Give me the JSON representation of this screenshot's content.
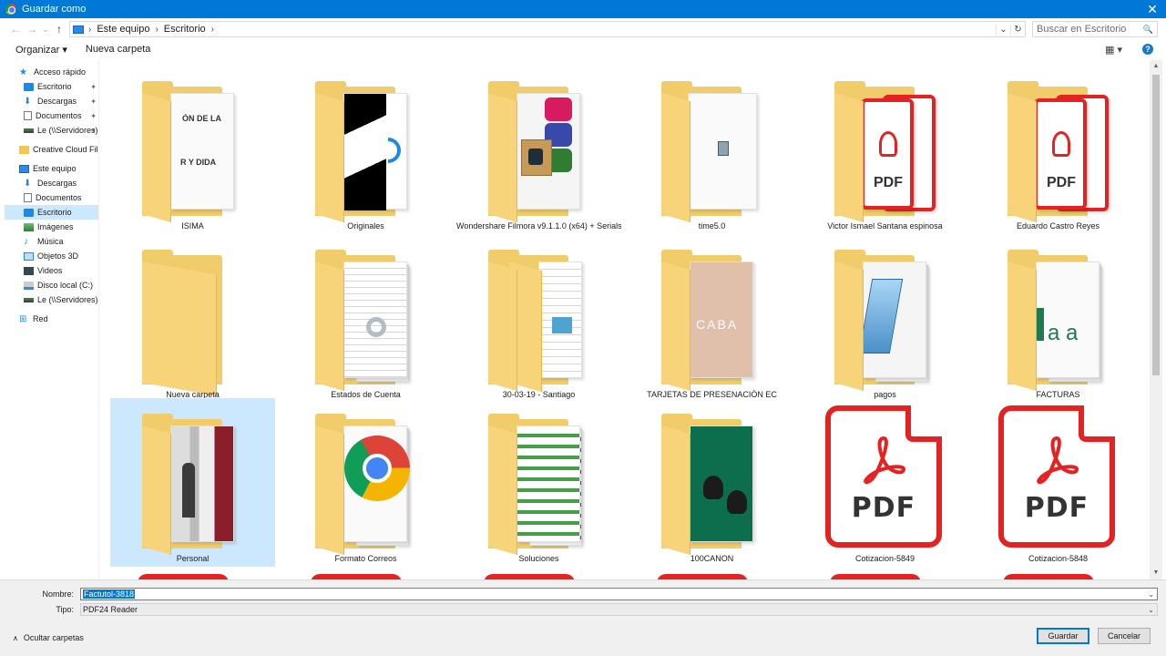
{
  "window": {
    "title": "Guardar como",
    "close_glyph": "✕",
    "app_icon": "chrome-icon"
  },
  "nav": {
    "back": "←",
    "forward": "→",
    "recent": "⌄",
    "up": "↑"
  },
  "address": {
    "segments": [
      "Este equipo",
      "Escritorio"
    ],
    "sep": "›",
    "dropdown": "⌄",
    "refresh": "↻"
  },
  "search": {
    "placeholder": "Buscar en Escritorio",
    "icon": "🔍"
  },
  "toolbar": {
    "organize": "Organizar ▾",
    "new_folder": "Nueva carpeta",
    "view": "▦ ▾",
    "help": "?"
  },
  "sidebar": {
    "items": [
      {
        "label": "Acceso rápido",
        "icon": "star-icon",
        "level": 0
      },
      {
        "label": "Escritorio",
        "icon": "desktop-folder-icon",
        "level": 1,
        "pinned": true
      },
      {
        "label": "Descargas",
        "icon": "download-icon",
        "level": 1,
        "pinned": true
      },
      {
        "label": "Documentos",
        "icon": "documents-icon",
        "level": 1,
        "pinned": true
      },
      {
        "label": "Le (\\\\Servidores)",
        "icon": "network-drive-icon",
        "level": 1,
        "pinned": true
      },
      {
        "label": "Creative Cloud Files",
        "icon": "creative-cloud-icon",
        "level": 0
      },
      {
        "label": "Este equipo",
        "icon": "computer-icon",
        "level": 0
      },
      {
        "label": "Descargas",
        "icon": "download-icon",
        "level": 1
      },
      {
        "label": "Documentos",
        "icon": "documents-icon",
        "level": 1
      },
      {
        "label": "Escritorio",
        "icon": "desktop-folder-icon",
        "level": 1,
        "selected": true
      },
      {
        "label": "Imágenes",
        "icon": "pictures-icon",
        "level": 1
      },
      {
        "label": "Música",
        "icon": "music-icon",
        "level": 1
      },
      {
        "label": "Objetos 3D",
        "icon": "objects3d-icon",
        "level": 1
      },
      {
        "label": "Videos",
        "icon": "videos-icon",
        "level": 1
      },
      {
        "label": "Disco local (C:)",
        "icon": "disk-icon",
        "level": 1
      },
      {
        "label": "Le (\\\\Servidores) (Z:",
        "icon": "network-drive-icon",
        "level": 1
      },
      {
        "label": "Red",
        "icon": "network-icon",
        "level": 0
      }
    ],
    "pin_glyph": "📌"
  },
  "files": [
    {
      "name": "ISIMA",
      "kind": "folder-doc"
    },
    {
      "name": "Originales",
      "kind": "folder-bw"
    },
    {
      "name": "Wondershare Filmora v9.1.1.0 (x64) + Serials",
      "kind": "folder-filmora"
    },
    {
      "name": "time5.0",
      "kind": "folder-app"
    },
    {
      "name": "Victor Ismael Santana espinosa",
      "kind": "folder-pdf"
    },
    {
      "name": "Eduardo Castro Reyes",
      "kind": "folder-pdf"
    },
    {
      "name": "Nueva carpeta",
      "kind": "folder-empty"
    },
    {
      "name": "Estados de Cuenta",
      "kind": "folder-sheet"
    },
    {
      "name": "30-03-19 - Santiago",
      "kind": "folder-doc2"
    },
    {
      "name": "TARJETAS DE PRESENACIÓN EC",
      "kind": "folder-card"
    },
    {
      "name": "pagos",
      "kind": "folder-notepad"
    },
    {
      "name": "FACTURAS",
      "kind": "folder-font"
    },
    {
      "name": "Personal",
      "kind": "folder-photo",
      "selected": true
    },
    {
      "name": "Formato Correos",
      "kind": "folder-chrome"
    },
    {
      "name": "Soluciones",
      "kind": "folder-excel"
    },
    {
      "name": "100CANON",
      "kind": "folder-green"
    },
    {
      "name": "Cotizacion-5849",
      "kind": "pdf"
    },
    {
      "name": "Cotizacion-5848",
      "kind": "pdf"
    }
  ],
  "pdf_label": "PDF",
  "thumb_text": {
    "isima_top": "ÓN DE LA",
    "isima_mid": "R Y DIDA",
    "font_sample": "a a",
    "card_text": "CABA"
  },
  "scroll": {
    "up": "▲",
    "down": "▼"
  },
  "footer": {
    "name_label": "Nombre:",
    "name_value": "Factutol-3818",
    "type_label": "Tipo:",
    "type_value": "PDF24 Reader",
    "dropdown": "⌄",
    "hide_folders": "Ocultar carpetas",
    "hide_chevron": "∧",
    "save": "Guardar",
    "cancel": "Cancelar"
  }
}
